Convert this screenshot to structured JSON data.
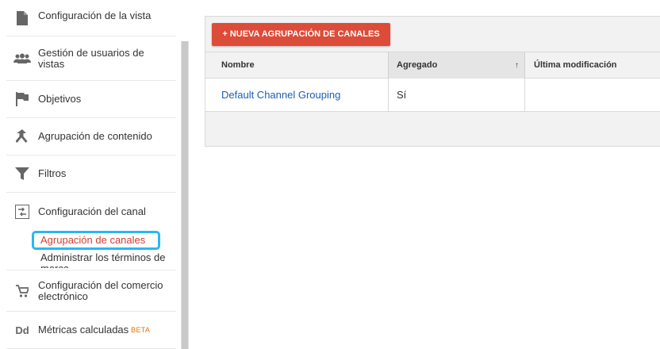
{
  "sidebar": {
    "items": [
      {
        "label": "Configuración de la vista",
        "icon": "document-icon"
      },
      {
        "label": "Gestión de usuarios de vistas",
        "icon": "users-icon"
      },
      {
        "label": "Objetivos",
        "icon": "flag-icon"
      },
      {
        "label": "Agrupación de contenido",
        "icon": "merge-icon"
      },
      {
        "label": "Filtros",
        "icon": "filter-icon"
      },
      {
        "label": "Configuración del canal",
        "icon": "channel-settings-icon"
      },
      {
        "label": "Configuración del comercio electrónico",
        "icon": "cart-icon"
      },
      {
        "label": "Métricas calculadas",
        "icon": "dd-icon",
        "badge": "BETA"
      }
    ],
    "sub_items": {
      "active": "Agrupación de canales",
      "next": "Administrar los términos de marca"
    },
    "icon_glyph_dd": "Dd"
  },
  "main": {
    "new_button_label": "+ NUEVA AGRUPACIÓN DE CANALES",
    "table": {
      "columns": [
        "Nombre",
        "Agregado",
        "Última modificación"
      ],
      "sort_indicator": "↑",
      "rows": [
        {
          "nombre": "Default Channel Grouping",
          "agregado": "Sí",
          "ultima": ""
        }
      ]
    }
  },
  "colors": {
    "accent_red": "#dd4b39",
    "active_sub_text": "#d23f31",
    "highlight_outline": "#29b6f6",
    "link_blue": "#1a5fb4"
  }
}
